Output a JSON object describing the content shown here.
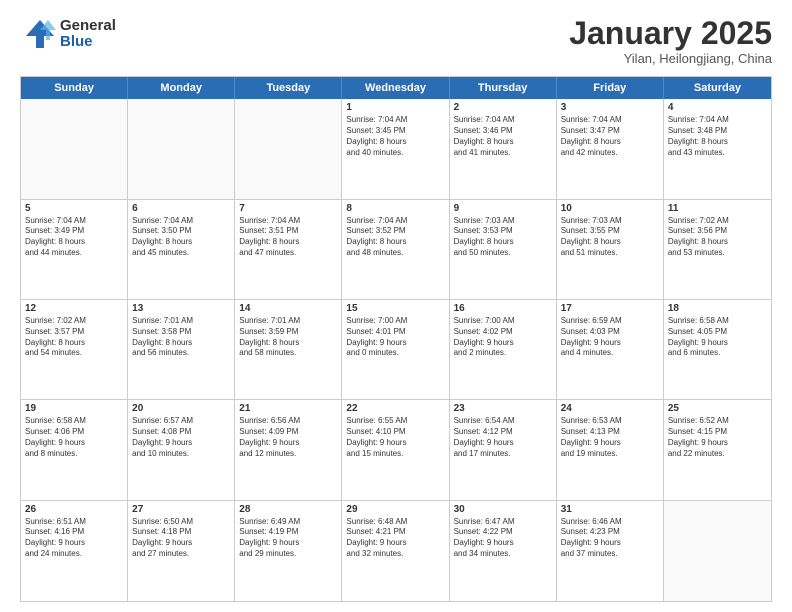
{
  "logo": {
    "general": "General",
    "blue": "Blue"
  },
  "title": "January 2025",
  "location": "Yilan, Heilongjiang, China",
  "header_days": [
    "Sunday",
    "Monday",
    "Tuesday",
    "Wednesday",
    "Thursday",
    "Friday",
    "Saturday"
  ],
  "weeks": [
    [
      {
        "day": "",
        "empty": true
      },
      {
        "day": "",
        "empty": true
      },
      {
        "day": "",
        "empty": true
      },
      {
        "day": "1",
        "info": "Sunrise: 7:04 AM\nSunset: 3:45 PM\nDaylight: 8 hours\nand 40 minutes."
      },
      {
        "day": "2",
        "info": "Sunrise: 7:04 AM\nSunset: 3:46 PM\nDaylight: 8 hours\nand 41 minutes."
      },
      {
        "day": "3",
        "info": "Sunrise: 7:04 AM\nSunset: 3:47 PM\nDaylight: 8 hours\nand 42 minutes."
      },
      {
        "day": "4",
        "info": "Sunrise: 7:04 AM\nSunset: 3:48 PM\nDaylight: 8 hours\nand 43 minutes."
      }
    ],
    [
      {
        "day": "5",
        "info": "Sunrise: 7:04 AM\nSunset: 3:49 PM\nDaylight: 8 hours\nand 44 minutes."
      },
      {
        "day": "6",
        "info": "Sunrise: 7:04 AM\nSunset: 3:50 PM\nDaylight: 8 hours\nand 45 minutes."
      },
      {
        "day": "7",
        "info": "Sunrise: 7:04 AM\nSunset: 3:51 PM\nDaylight: 8 hours\nand 47 minutes."
      },
      {
        "day": "8",
        "info": "Sunrise: 7:04 AM\nSunset: 3:52 PM\nDaylight: 8 hours\nand 48 minutes."
      },
      {
        "day": "9",
        "info": "Sunrise: 7:03 AM\nSunset: 3:53 PM\nDaylight: 8 hours\nand 50 minutes."
      },
      {
        "day": "10",
        "info": "Sunrise: 7:03 AM\nSunset: 3:55 PM\nDaylight: 8 hours\nand 51 minutes."
      },
      {
        "day": "11",
        "info": "Sunrise: 7:02 AM\nSunset: 3:56 PM\nDaylight: 8 hours\nand 53 minutes."
      }
    ],
    [
      {
        "day": "12",
        "info": "Sunrise: 7:02 AM\nSunset: 3:57 PM\nDaylight: 8 hours\nand 54 minutes."
      },
      {
        "day": "13",
        "info": "Sunrise: 7:01 AM\nSunset: 3:58 PM\nDaylight: 8 hours\nand 56 minutes."
      },
      {
        "day": "14",
        "info": "Sunrise: 7:01 AM\nSunset: 3:59 PM\nDaylight: 8 hours\nand 58 minutes."
      },
      {
        "day": "15",
        "info": "Sunrise: 7:00 AM\nSunset: 4:01 PM\nDaylight: 9 hours\nand 0 minutes."
      },
      {
        "day": "16",
        "info": "Sunrise: 7:00 AM\nSunset: 4:02 PM\nDaylight: 9 hours\nand 2 minutes."
      },
      {
        "day": "17",
        "info": "Sunrise: 6:59 AM\nSunset: 4:03 PM\nDaylight: 9 hours\nand 4 minutes."
      },
      {
        "day": "18",
        "info": "Sunrise: 6:58 AM\nSunset: 4:05 PM\nDaylight: 9 hours\nand 6 minutes."
      }
    ],
    [
      {
        "day": "19",
        "info": "Sunrise: 6:58 AM\nSunset: 4:06 PM\nDaylight: 9 hours\nand 8 minutes."
      },
      {
        "day": "20",
        "info": "Sunrise: 6:57 AM\nSunset: 4:08 PM\nDaylight: 9 hours\nand 10 minutes."
      },
      {
        "day": "21",
        "info": "Sunrise: 6:56 AM\nSunset: 4:09 PM\nDaylight: 9 hours\nand 12 minutes."
      },
      {
        "day": "22",
        "info": "Sunrise: 6:55 AM\nSunset: 4:10 PM\nDaylight: 9 hours\nand 15 minutes."
      },
      {
        "day": "23",
        "info": "Sunrise: 6:54 AM\nSunset: 4:12 PM\nDaylight: 9 hours\nand 17 minutes."
      },
      {
        "day": "24",
        "info": "Sunrise: 6:53 AM\nSunset: 4:13 PM\nDaylight: 9 hours\nand 19 minutes."
      },
      {
        "day": "25",
        "info": "Sunrise: 6:52 AM\nSunset: 4:15 PM\nDaylight: 9 hours\nand 22 minutes."
      }
    ],
    [
      {
        "day": "26",
        "info": "Sunrise: 6:51 AM\nSunset: 4:16 PM\nDaylight: 9 hours\nand 24 minutes."
      },
      {
        "day": "27",
        "info": "Sunrise: 6:50 AM\nSunset: 4:18 PM\nDaylight: 9 hours\nand 27 minutes."
      },
      {
        "day": "28",
        "info": "Sunrise: 6:49 AM\nSunset: 4:19 PM\nDaylight: 9 hours\nand 29 minutes."
      },
      {
        "day": "29",
        "info": "Sunrise: 6:48 AM\nSunset: 4:21 PM\nDaylight: 9 hours\nand 32 minutes."
      },
      {
        "day": "30",
        "info": "Sunrise: 6:47 AM\nSunset: 4:22 PM\nDaylight: 9 hours\nand 34 minutes."
      },
      {
        "day": "31",
        "info": "Sunrise: 6:46 AM\nSunset: 4:23 PM\nDaylight: 9 hours\nand 37 minutes."
      },
      {
        "day": "",
        "empty": true
      }
    ]
  ]
}
